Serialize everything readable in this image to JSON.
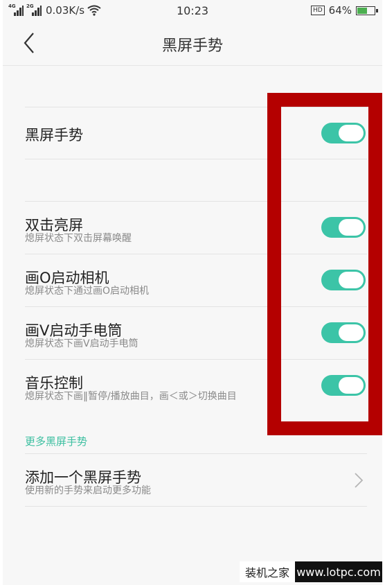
{
  "status_bar": {
    "sim1_label": "4G",
    "sim2_label": "2G",
    "net_speed": "0.03K/s",
    "time": "10:23",
    "hd_badge": "HD",
    "battery_percent": "64%",
    "battery_level": 0.64
  },
  "header": {
    "back_icon": "chevron-left-icon",
    "title": "黑屏手势"
  },
  "main_toggle": {
    "label": "黑屏手势",
    "on": true
  },
  "gestures": [
    {
      "title": "双击亮屏",
      "subtitle": "熄屏状态下双击屏幕唤醒",
      "on": true
    },
    {
      "title": "画O启动相机",
      "subtitle": "熄屏状态下通过画O启动相机",
      "on": true
    },
    {
      "title": "画V启动手电筒",
      "subtitle": "熄屏状态下画V启动手电筒",
      "on": true
    },
    {
      "title": "音乐控制",
      "subtitle": "熄屏状态下画‖暂停/播放曲目，画＜或＞切换曲目",
      "on": true
    }
  ],
  "more_section": {
    "label": "更多黑屏手势",
    "add_item": {
      "title": "添加一个黑屏手势",
      "subtitle": "使用新的手势来启动更多功能"
    }
  },
  "watermark": {
    "left_text": "装机之家",
    "right_text": "www.lotpc.com"
  },
  "colors": {
    "toggle_on": "#3cc4a7",
    "accent_text": "#3cbfa0",
    "highlight_border": "#b40000"
  }
}
